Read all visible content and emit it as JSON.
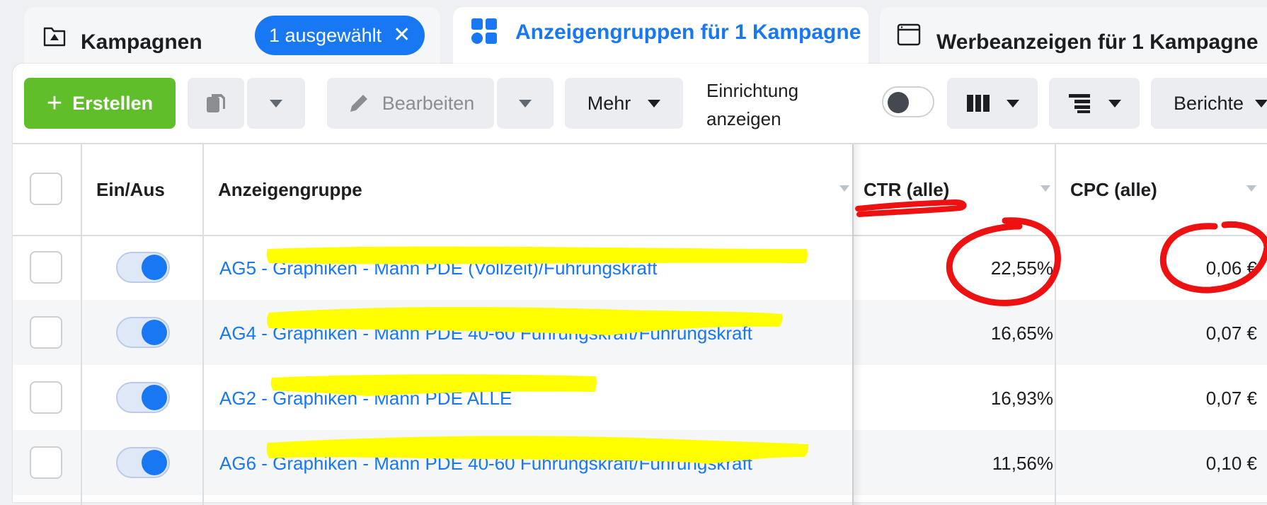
{
  "tabs": [
    {
      "label": "Kampagnen",
      "icon": "folder-flag-icon",
      "selection_chip": "1 ausgewählt"
    },
    {
      "label": "Anzeigengruppen für 1 Kampagne",
      "icon": "grid-icon",
      "active": true
    },
    {
      "label": "Werbeanzeigen für 1 Kampagne",
      "icon": "ad-window-icon"
    }
  ],
  "toolbar": {
    "create_label": "Erstellen",
    "edit_label": "Bearbeiten",
    "more_label": "Mehr",
    "setup_label_line1": "Einrichtung",
    "setup_label_line2": "anzeigen",
    "reports_label": "Berichte"
  },
  "table": {
    "headers": {
      "toggle": "Ein/Aus",
      "name": "Anzeigengruppe",
      "ctr": "CTR (alle)",
      "cpc": "CPC (alle)"
    },
    "rows": [
      {
        "name": "AG5 - Graphiken - Mann PDE (Vollzeit)/Führungskraft",
        "ctr": "22,55%",
        "cpc": "0,06 €",
        "on": true
      },
      {
        "name": "AG4 - Graphiken - Mann PDE 40-60 Führungskraft/Führungskraft",
        "ctr": "16,65%",
        "cpc": "0,07 €",
        "on": true
      },
      {
        "name": "AG2 - Graphiken - Mann PDE ALLE",
        "ctr": "16,93%",
        "cpc": "0,07 €",
        "on": true
      },
      {
        "name": "AG6 - Graphiken - Mann PDE 40-60 Führungskraft/Führungskraft",
        "ctr": "11,56%",
        "cpc": "0,10 €",
        "on": true
      }
    ]
  },
  "colors": {
    "accent": "#1877f2",
    "create_green": "#5fbe2a",
    "annotation_red": "#ee1111",
    "redaction_yellow": "#ffff00"
  }
}
